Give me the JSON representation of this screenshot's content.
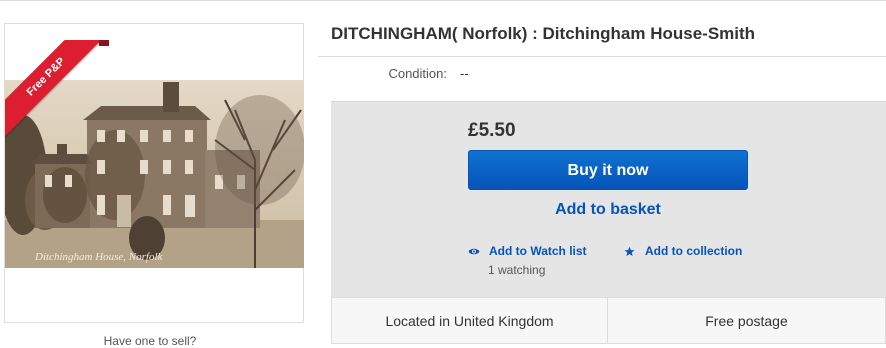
{
  "listing": {
    "title": "DITCHINGHAM( Norfolk) : Ditchingham House-Smith",
    "condition_label": "Condition:",
    "condition_value": "--",
    "ribbon": "Free P&P",
    "photo_caption": "Ditchingham House, Norfolk",
    "caption_under": "Have one to sell?"
  },
  "buy_box": {
    "price": "£5.50",
    "buy_now_label": "Buy it now",
    "add_to_basket_label": "Add to basket",
    "watch_label": "Add to Watch list",
    "watching_count": "1 watching",
    "collection_label": "Add to collection",
    "watch_icon": "eye-icon",
    "collection_icon": "star-icon"
  },
  "footer": {
    "location": "Located in United Kingdom",
    "postage": "Free postage"
  },
  "colors": {
    "accent_blue": "#0654ba",
    "ribbon_red": "#dd1e31",
    "panel_grey": "#e5e5e5"
  }
}
